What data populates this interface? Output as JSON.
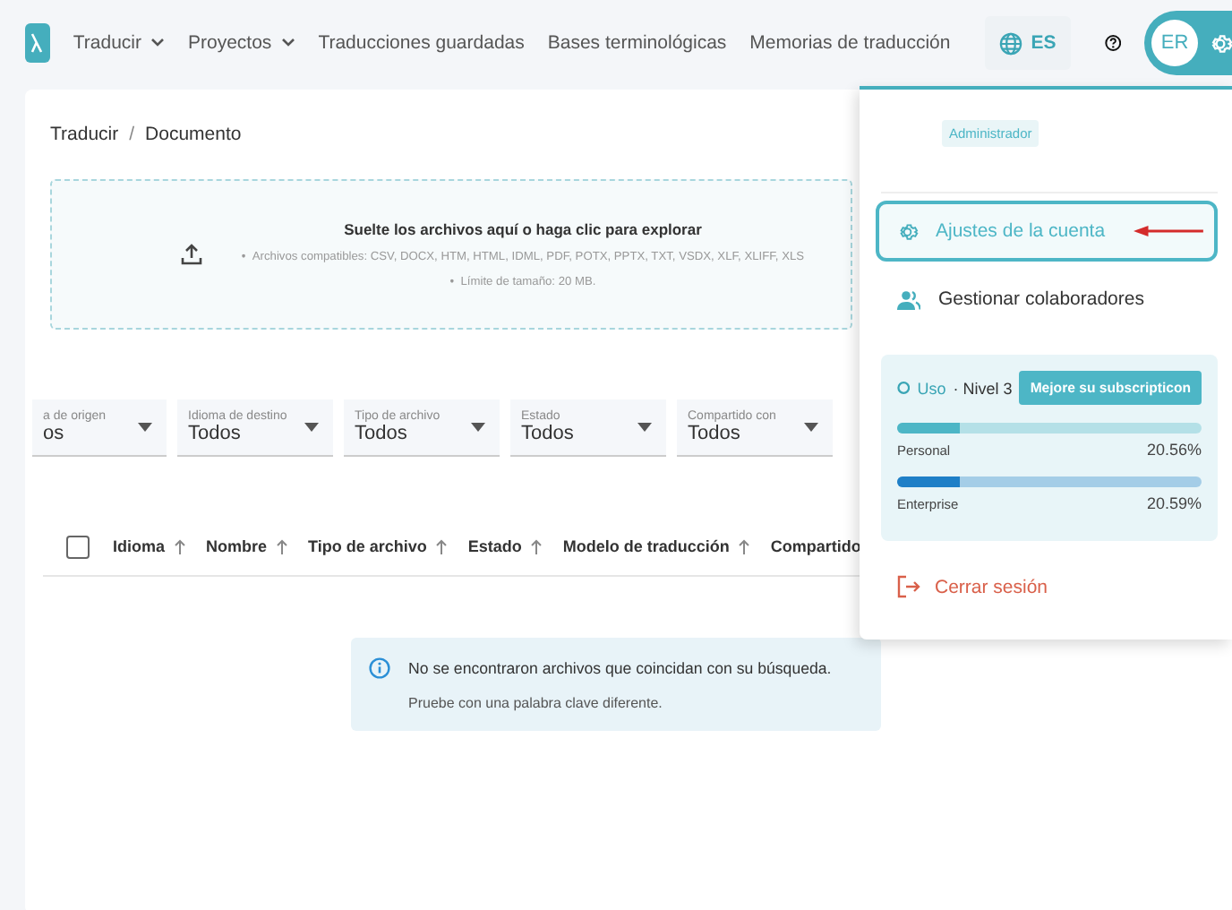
{
  "nav": {
    "items": [
      {
        "label": "Traducir",
        "has_menu": true
      },
      {
        "label": "Proyectos",
        "has_menu": true
      },
      {
        "label": "Traducciones guardadas",
        "has_menu": false
      },
      {
        "label": "Bases terminológicas",
        "has_menu": false
      },
      {
        "label": "Memorias de traducción",
        "has_menu": false
      }
    ],
    "language": "ES",
    "avatar": "ER"
  },
  "breadcrumb": {
    "items": [
      "Traducir",
      "Documento"
    ],
    "separator": "/"
  },
  "dropzone": {
    "bullet": "•",
    "title": "Suelte los archivos aquí o haga clic para explorar",
    "bullets": [
      "Archivos compatibles: CSV, DOCX, HTM, HTML, IDML, PDF, POTX, PPTX, TXT, VSDX, XLF, XLIFF, XLS",
      "Límite de tamaño: 20 MB."
    ]
  },
  "filters": [
    {
      "label": "a de origen",
      "value": "os"
    },
    {
      "label": "Idioma de destino",
      "value": "Todos"
    },
    {
      "label": "Tipo de archivo",
      "value": "Todos"
    },
    {
      "label": "Estado",
      "value": "Todos"
    },
    {
      "label": "Compartido con",
      "value": "Todos"
    }
  ],
  "table": {
    "select_all_checked": false,
    "columns": [
      "Idioma",
      "Nombre",
      "Tipo de archivo",
      "Estado",
      "Modelo de traducción",
      "Compartido"
    ]
  },
  "empty": {
    "title": "No se encontraron archivos que coincidan con su búsqueda.",
    "hint": "Pruebe con una palabra clave diferente."
  },
  "menu": {
    "role": "Administrador",
    "items": [
      {
        "kind": "settings",
        "label": "Ajustes de la cuenta",
        "selected": true
      },
      {
        "kind": "collaborators",
        "label": "Gestionar colaboradores",
        "selected": false
      }
    ],
    "usage": {
      "label": "Uso",
      "tier": "· Nivel 3",
      "button": "Mejore su subscripticon",
      "meters": [
        {
          "name": "Personal",
          "level": 0.2056,
          "reading": "20.56%",
          "color": "#4db6c6"
        },
        {
          "name": "Enterprise",
          "level": 0.2059,
          "reading": "20.59%",
          "color": "#1e7fc7"
        }
      ]
    },
    "logout": "Cerrar sesión"
  }
}
